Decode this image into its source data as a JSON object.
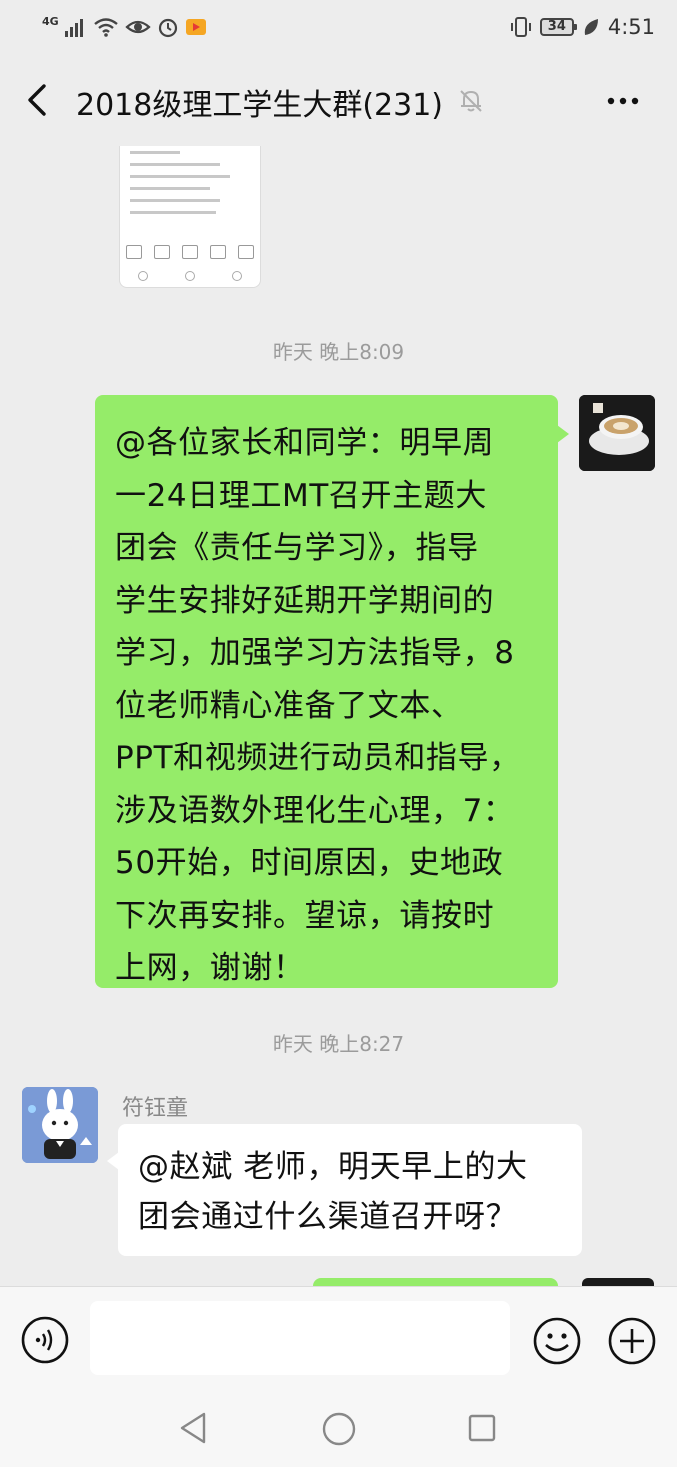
{
  "status_bar": {
    "network": "4G",
    "battery": "34",
    "time": "4:51"
  },
  "header": {
    "title": "2018级理工学生大群(231)"
  },
  "chat": {
    "timestamps": [
      "昨天 晚上8:09",
      "昨天 晚上8:27"
    ],
    "messages": [
      {
        "side": "right",
        "lines": [
          "@各位家长和同学：明早周",
          "一24日理工MT召开主题大",
          "团会《责任与学习》，指导",
          "学生安排好延期开学期间的",
          "学习，加强学习方法指导，8",
          "位老师精心准备了文本、",
          "PPT和视频进行动员和指导，",
          "涉及语数外理化生心理，7：",
          "50开始，时间原因，史地政",
          "下次再安排。望谅，请按时",
          "上网，谢谢！"
        ]
      },
      {
        "side": "left",
        "sender": "符钰童",
        "lines": [
          "@赵斌  老师，明天早上的大",
          "团会通过什么渠道召开呀？"
        ]
      }
    ]
  },
  "input_bar": {
    "value": "",
    "placeholder": ""
  },
  "colors": {
    "background": "#ededed",
    "bubble_self": "#95ec69",
    "bubble_other": "#ffffff"
  }
}
